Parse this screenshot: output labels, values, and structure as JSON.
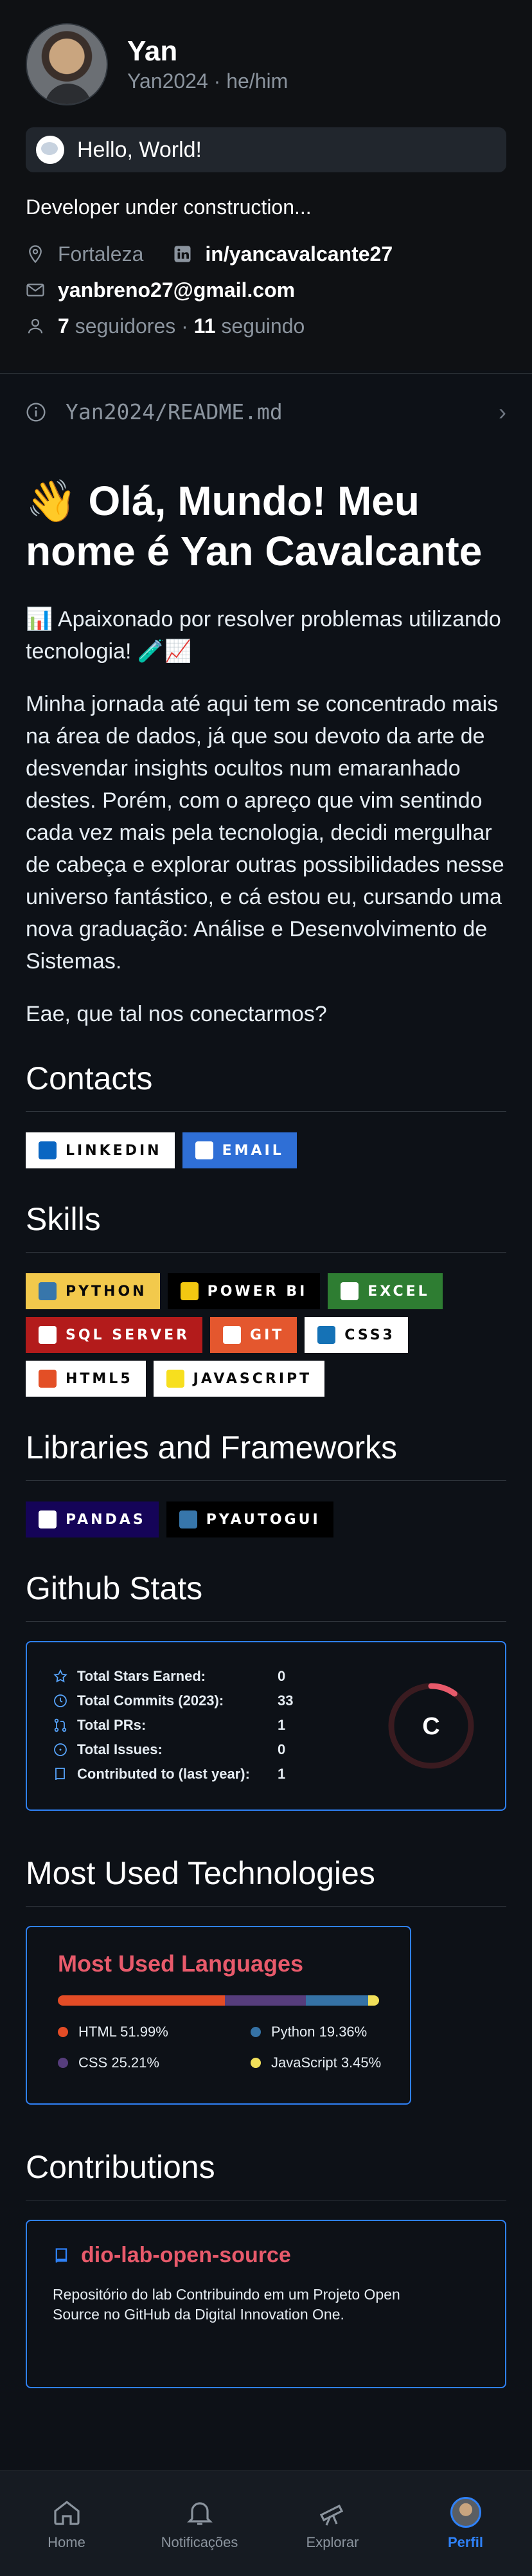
{
  "profile": {
    "name": "Yan",
    "login_line": "Yan2024 · he/him",
    "status": "Hello, World!",
    "bio": "Developer under construction...",
    "location": "Fortaleza",
    "linkedin": "in/yancavalcante27",
    "email": "yanbreno27@gmail.com",
    "followers_count": "7",
    "followers_label": "seguidores",
    "dot": "·",
    "following_count": "11",
    "following_label": "seguindo"
  },
  "readme": {
    "path": "Yan2024/README.md",
    "heading": "👋 Olá, Mundo! Meu nome é Yan Cavalcante",
    "intro": "📊 Apaixonado por resolver problemas utilizando tecnologia! 🧪📈",
    "paragraph": "Minha jornada até aqui tem se concentrado mais na área de dados, já que sou devoto da arte de desvendar insights ocultos num emaranhado destes. Porém, com o apreço que vim sentindo cada vez mais pela tecnologia, decidi mergulhar de cabeça e explorar outras possibilidades nesse universo fantástico, e cá estou eu, cursando uma nova graduação: Análise e Desenvolvimento de Sistemas.",
    "closing": "Eae, que tal nos conectarmos?"
  },
  "sections": {
    "contacts": "Contacts",
    "skills": "Skills",
    "libraries": "Libraries and Frameworks",
    "github_stats": "Github Stats",
    "most_used": "Most Used Technologies",
    "contributions": "Contributions"
  },
  "badges": {
    "contacts": [
      {
        "label": "LINKEDIN",
        "bg": "#ffffff",
        "fg": "#0a0a0a",
        "icon": "#0a66c2"
      },
      {
        "label": "EMAIL",
        "bg": "#2f6fd6",
        "fg": "#ffffff",
        "icon": "#ffffff"
      }
    ],
    "skills": [
      {
        "label": "PYTHON",
        "bg": "#f2c94c",
        "fg": "#0a0a0a",
        "icon": "#3776ab"
      },
      {
        "label": "POWER BI",
        "bg": "#000000",
        "fg": "#ffffff",
        "icon": "#f2c811"
      },
      {
        "label": "EXCEL",
        "bg": "#2e7d32",
        "fg": "#ffffff",
        "icon": "#ffffff"
      },
      {
        "label": "SQL SERVER",
        "bg": "#b31b1b",
        "fg": "#ffffff",
        "icon": "#ffffff"
      },
      {
        "label": "GIT",
        "bg": "#e4572e",
        "fg": "#ffffff",
        "icon": "#ffffff"
      },
      {
        "label": "CSS3",
        "bg": "#ffffff",
        "fg": "#0a0a0a",
        "icon": "#1572b6"
      },
      {
        "label": "HTML5",
        "bg": "#ffffff",
        "fg": "#0a0a0a",
        "icon": "#e34f26"
      },
      {
        "label": "JAVASCRIPT",
        "bg": "#ffffff",
        "fg": "#0a0a0a",
        "icon": "#f7df1e"
      }
    ],
    "libraries": [
      {
        "label": "PANDAS",
        "bg": "#150458",
        "fg": "#ffffff",
        "icon": "#ffffff"
      },
      {
        "label": "PYAUTOGUI",
        "bg": "#000000",
        "fg": "#ffffff",
        "icon": "#3776ab"
      }
    ]
  },
  "stats": {
    "rows": [
      {
        "label": "Total Stars Earned:",
        "value": "0",
        "icon": "star-icon"
      },
      {
        "label": "Total Commits (2023):",
        "value": "33",
        "icon": "history-icon"
      },
      {
        "label": "Total PRs:",
        "value": "1",
        "icon": "pull-request-icon"
      },
      {
        "label": "Total Issues:",
        "value": "0",
        "icon": "issue-icon"
      },
      {
        "label": "Contributed to (last year):",
        "value": "1",
        "icon": "repo-icon"
      }
    ],
    "grade": "C",
    "grade_progress": 0.1
  },
  "languages": {
    "title": "Most Used Languages",
    "items": [
      {
        "name": "HTML",
        "pct": 51.99,
        "label": "HTML 51.99%",
        "color": "#e34c26"
      },
      {
        "name": "CSS",
        "pct": 25.21,
        "label": "CSS 25.21%",
        "color": "#563d7c"
      },
      {
        "name": "Python",
        "pct": 19.36,
        "label": "Python 19.36%",
        "color": "#3572a5"
      },
      {
        "name": "JavaScript",
        "pct": 3.45,
        "label": "JavaScript 3.45%",
        "color": "#f1e05a"
      }
    ]
  },
  "repo": {
    "name": "dio-lab-open-source",
    "description": "Repositório do lab Contribuindo em um Projeto Open Source no GitHub da Digital Innovation One."
  },
  "nav": {
    "home": "Home",
    "notifications": "Notificações",
    "explore": "Explorar",
    "profile": "Perfil"
  },
  "colors": {
    "accent_red": "#fe428e",
    "stats_title": "#e85a6b",
    "card_border": "#2f81f7",
    "nav_active": "#2f81f7"
  }
}
